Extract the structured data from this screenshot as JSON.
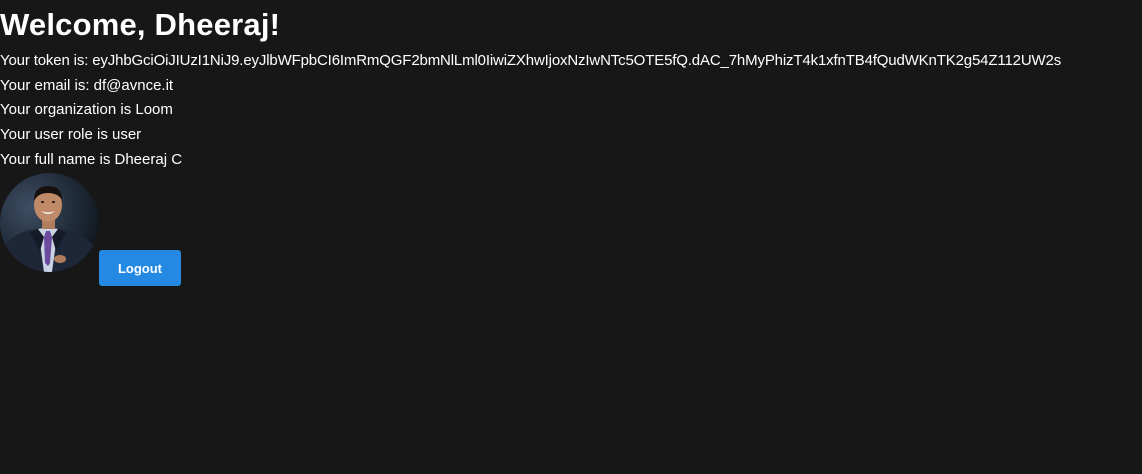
{
  "header": {
    "title": "Welcome, Dheeraj!"
  },
  "profile": {
    "token_line": "Your token is: eyJhbGciOiJIUzI1NiJ9.eyJlbWFpbCI6ImRmQGF2bmNlLml0IiwiZXhwIjoxNzIwNTc5OTE5fQ.dAC_7hMyPhizT4k1xfnTB4fQudWKnTK2g54Z112UW2s",
    "email_line": "Your email is: df@avnce.it",
    "organization_line": "Your organization is Loom",
    "role_line": "Your user role is user",
    "full_name_line": "Your full name is Dheeraj C"
  },
  "actions": {
    "logout_label": "Logout"
  },
  "colors": {
    "background": "#171717",
    "text": "#ffffff",
    "button": "#2389e3"
  }
}
